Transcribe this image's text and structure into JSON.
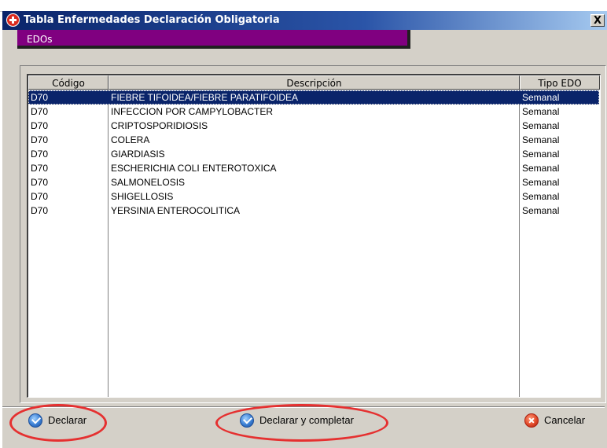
{
  "window": {
    "title": "Tabla Enfermedades Declaración Obligatoria",
    "close_glyph": "X",
    "icon": "app-cross-icon"
  },
  "tab": {
    "label": "EDOs"
  },
  "table": {
    "columns": [
      "Código",
      "Descripción",
      "Tipo EDO"
    ],
    "rows": [
      {
        "codigo": "D70",
        "descripcion": "FIEBRE TIFOIDEA/FIEBRE PARATIFOIDEA",
        "tipo": "Semanal",
        "selected": true
      },
      {
        "codigo": "D70",
        "descripcion": "INFECCION POR CAMPYLOBACTER",
        "tipo": "Semanal"
      },
      {
        "codigo": "D70",
        "descripcion": "CRIPTOSPORIDIOSIS",
        "tipo": "Semanal"
      },
      {
        "codigo": "D70",
        "descripcion": "COLERA",
        "tipo": "Semanal"
      },
      {
        "codigo": "D70",
        "descripcion": "GIARDIASIS",
        "tipo": "Semanal"
      },
      {
        "codigo": "D70",
        "descripcion": "ESCHERICHIA COLI ENTEROTOXICA",
        "tipo": "Semanal"
      },
      {
        "codigo": "D70",
        "descripcion": "SALMONELOSIS",
        "tipo": "Semanal"
      },
      {
        "codigo": "D70",
        "descripcion": "SHIGELLOSIS",
        "tipo": "Semanal"
      },
      {
        "codigo": "D70",
        "descripcion": "YERSINIA ENTEROCOLITICA",
        "tipo": "Semanal"
      }
    ]
  },
  "buttons": {
    "declarar": {
      "accel": "D",
      "rest": "eclarar",
      "icon": "check-circle-icon"
    },
    "declarar_completar": {
      "accel": "D",
      "rest": "eclarar y completar",
      "icon": "check-circle-icon"
    },
    "cancelar": {
      "accel": "C",
      "rest": "ancelar",
      "icon": "cancel-circle-icon"
    }
  },
  "colors": {
    "titlebar": "#0a246a",
    "tab": "#800080",
    "selection": "#0a246a",
    "annotation": "#e53030"
  }
}
